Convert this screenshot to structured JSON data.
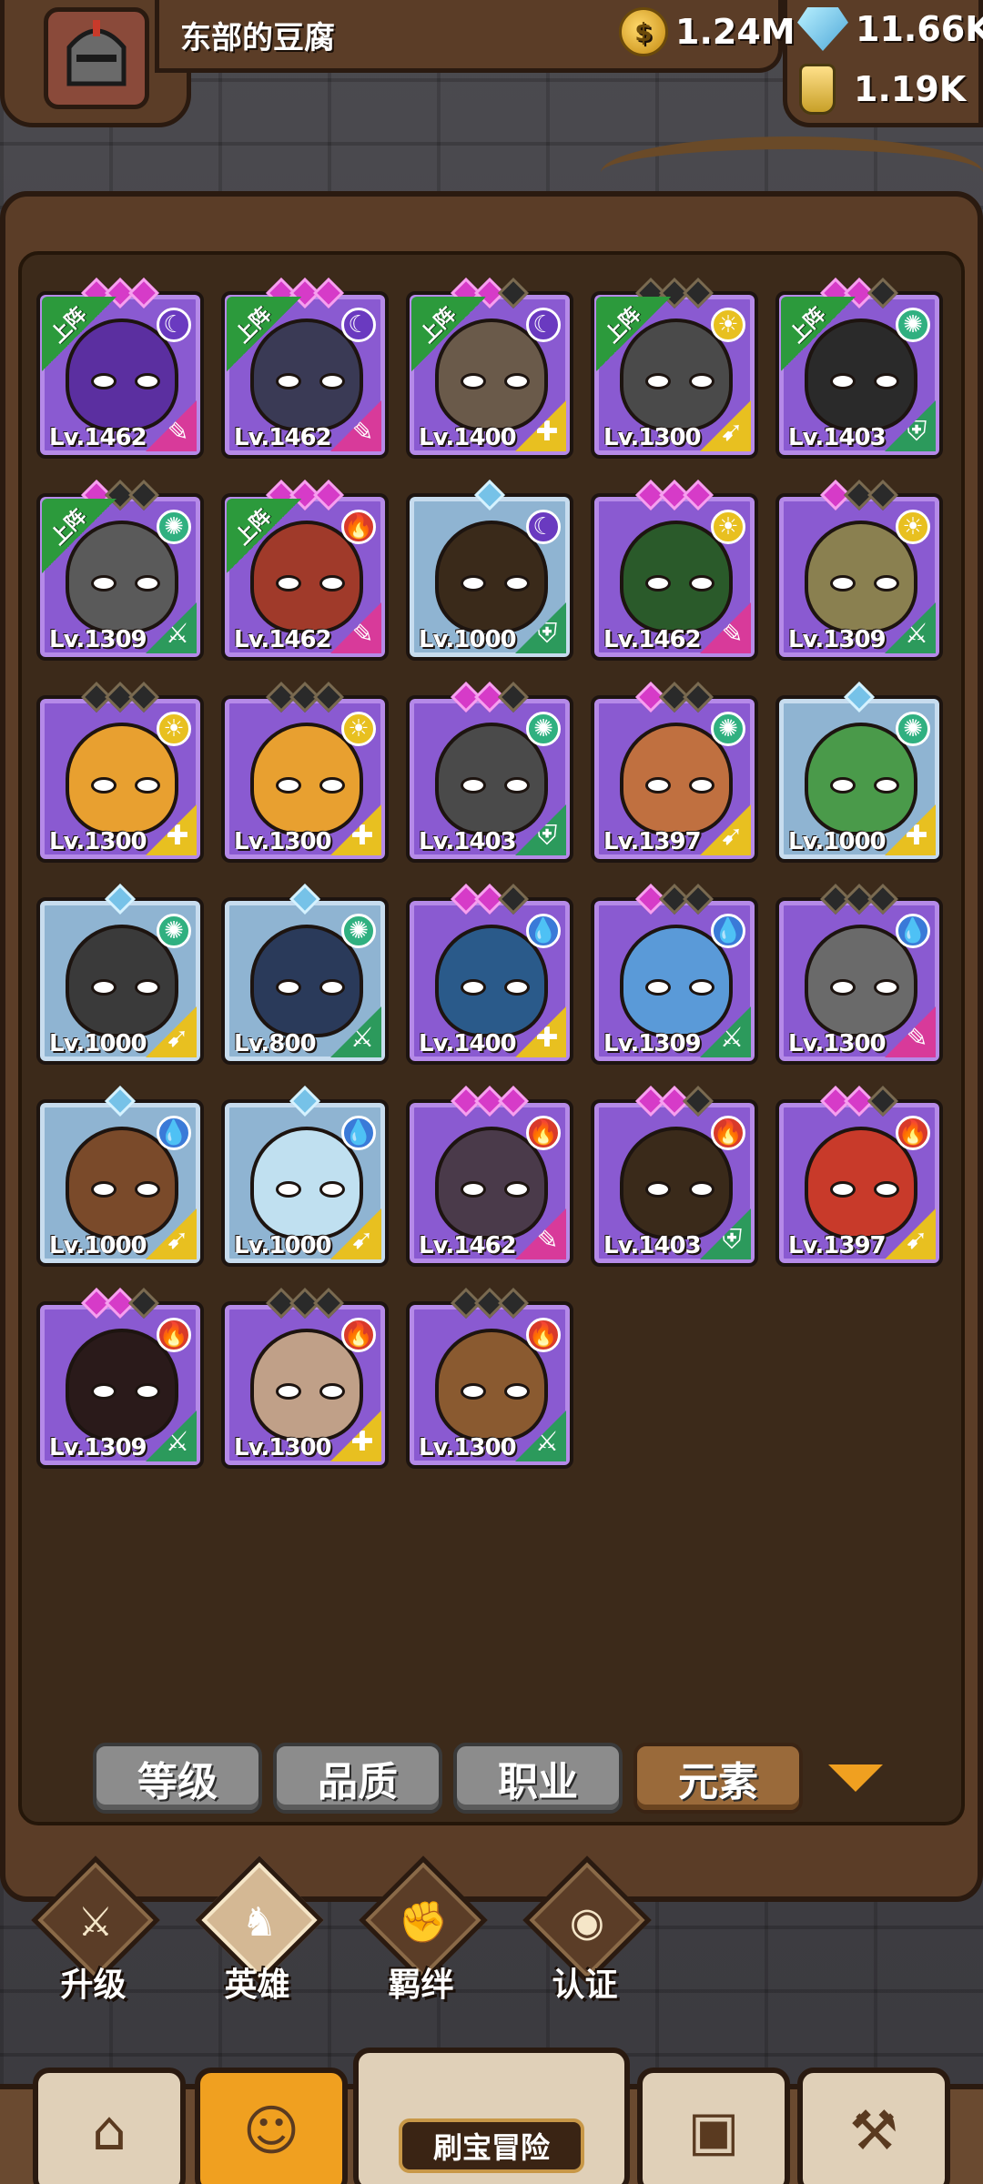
{
  "player": {
    "name": "东部的豆腐",
    "avatar_icon": "knight-helmet-icon"
  },
  "resources": [
    {
      "name": "gold",
      "icon": "gold-coin-icon",
      "value": "1.24M"
    },
    {
      "name": "gem",
      "icon": "blue-gem-icon",
      "value": "11.66K"
    },
    {
      "name": "potion",
      "icon": "potion-jar-icon",
      "value": "1.19K"
    }
  ],
  "deploy_label": "上阵",
  "element_colors": {
    "moon": "#6a3ac0",
    "sun": "#e8c020",
    "wind": "#30b080",
    "water": "#3a7ad8",
    "fire": "#d83a2a"
  },
  "heroes": [
    {
      "level": "Lv.1462",
      "quality": "epic",
      "stars": 3,
      "element": "moon",
      "class": "mage",
      "deployed": true,
      "face": "#5b2fa0"
    },
    {
      "level": "Lv.1462",
      "quality": "epic",
      "stars": 3,
      "element": "moon",
      "class": "mage",
      "deployed": true,
      "face": "#3a3a55"
    },
    {
      "level": "Lv.1400",
      "quality": "epic",
      "stars": 2,
      "element": "moon",
      "class": "support",
      "deployed": true,
      "face": "#6a5a4a"
    },
    {
      "level": "Lv.1300",
      "quality": "epic",
      "stars": 0,
      "element": "sun",
      "class": "archer",
      "deployed": true,
      "face": "#4a4a4a"
    },
    {
      "level": "Lv.1403",
      "quality": "epic",
      "stars": 2,
      "element": "wind",
      "class": "tank",
      "deployed": true,
      "face": "#2a2a2a"
    },
    {
      "level": "Lv.1309",
      "quality": "epic",
      "stars": 1,
      "element": "wind",
      "class": "warrior",
      "deployed": true,
      "face": "#5a5a5a"
    },
    {
      "level": "Lv.1462",
      "quality": "epic",
      "stars": 3,
      "element": "fire",
      "class": "mage",
      "deployed": true,
      "face": "#a03a2a"
    },
    {
      "level": "Lv.1000",
      "quality": "rare",
      "stars": 1,
      "element": "moon",
      "class": "tank",
      "deployed": false,
      "face": "#3a2a1a"
    },
    {
      "level": "Lv.1462",
      "quality": "epic",
      "stars": 3,
      "element": "sun",
      "class": "mage",
      "deployed": false,
      "face": "#2a5a2a"
    },
    {
      "level": "Lv.1309",
      "quality": "epic",
      "stars": 1,
      "element": "sun",
      "class": "warrior",
      "deployed": false,
      "face": "#8a8050"
    },
    {
      "level": "Lv.1300",
      "quality": "epic",
      "stars": 0,
      "element": "sun",
      "class": "support",
      "deployed": false,
      "face": "#e8a030"
    },
    {
      "level": "Lv.1300",
      "quality": "epic",
      "stars": 0,
      "element": "sun",
      "class": "support",
      "deployed": false,
      "face": "#e8a030"
    },
    {
      "level": "Lv.1403",
      "quality": "epic",
      "stars": 2,
      "element": "wind",
      "class": "tank",
      "deployed": false,
      "face": "#4a4a4a"
    },
    {
      "level": "Lv.1397",
      "quality": "epic",
      "stars": 1,
      "element": "wind",
      "class": "archer",
      "deployed": false,
      "face": "#c07040"
    },
    {
      "level": "Lv.1000",
      "quality": "rare",
      "stars": 1,
      "element": "wind",
      "class": "support",
      "deployed": false,
      "face": "#4a9a4a"
    },
    {
      "level": "Lv.1000",
      "quality": "rare",
      "stars": 1,
      "element": "wind",
      "class": "archer",
      "deployed": false,
      "face": "#3a3a3a"
    },
    {
      "level": "Lv.800",
      "quality": "rare",
      "stars": 0,
      "element": "wind",
      "class": "warrior",
      "deployed": false,
      "face": "#2a3a5a"
    },
    {
      "level": "Lv.1400",
      "quality": "epic",
      "stars": 2,
      "element": "water",
      "class": "support",
      "deployed": false,
      "face": "#2a5a8a"
    },
    {
      "level": "Lv.1309",
      "quality": "epic",
      "stars": 1,
      "element": "water",
      "class": "warrior",
      "deployed": false,
      "face": "#5a9ad8"
    },
    {
      "level": "Lv.1300",
      "quality": "epic",
      "stars": 0,
      "element": "water",
      "class": "mage",
      "deployed": false,
      "face": "#6a6a6a"
    },
    {
      "level": "Lv.1000",
      "quality": "rare",
      "stars": 1,
      "element": "water",
      "class": "archer",
      "deployed": false,
      "face": "#7a4a2a"
    },
    {
      "level": "Lv.1000",
      "quality": "rare",
      "stars": 1,
      "element": "water",
      "class": "archer",
      "deployed": false,
      "face": "#c0e0f0"
    },
    {
      "level": "Lv.1462",
      "quality": "epic",
      "stars": 3,
      "element": "fire",
      "class": "mage",
      "deployed": false,
      "face": "#4a3a4a"
    },
    {
      "level": "Lv.1403",
      "quality": "epic",
      "stars": 2,
      "element": "fire",
      "class": "tank",
      "deployed": false,
      "face": "#3a2a1a"
    },
    {
      "level": "Lv.1397",
      "quality": "epic",
      "stars": 2,
      "element": "fire",
      "class": "archer",
      "deployed": false,
      "face": "#c83a2a"
    },
    {
      "level": "Lv.1309",
      "quality": "epic",
      "stars": 2,
      "element": "fire",
      "class": "warrior",
      "deployed": false,
      "face": "#2a1a1a"
    },
    {
      "level": "Lv.1300",
      "quality": "epic",
      "stars": 0,
      "element": "fire",
      "class": "support",
      "deployed": false,
      "face": "#c0a088"
    },
    {
      "level": "Lv.1300",
      "quality": "epic",
      "stars": 0,
      "element": "fire",
      "class": "warrior",
      "deployed": false,
      "face": "#8a5a30"
    }
  ],
  "sort_buttons": [
    {
      "label": "等级",
      "active": false
    },
    {
      "label": "品质",
      "active": false
    },
    {
      "label": "职业",
      "active": false
    },
    {
      "label": "元素",
      "active": true
    }
  ],
  "menu": [
    {
      "label": "升级",
      "icon": "sword-icon",
      "active": false
    },
    {
      "label": "英雄",
      "icon": "hero-helmet-icon",
      "active": true
    },
    {
      "label": "羁绊",
      "icon": "handshake-icon",
      "active": false
    },
    {
      "label": "认证",
      "icon": "eye-icon",
      "active": false
    }
  ],
  "bottom_nav": {
    "shop_icon": "shop-icon",
    "heroes_icon": "hero-portrait-icon",
    "adventure_label": "刷宝冒险",
    "inventory_icon": "backpack-icon",
    "forge_icon": "hammer-icon"
  }
}
